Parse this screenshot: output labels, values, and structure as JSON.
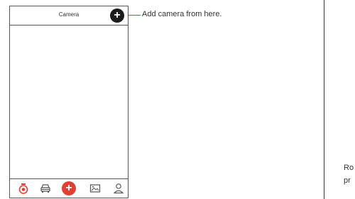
{
  "screen": {
    "title": "Camera",
    "add_button_symbol": "+"
  },
  "tabbar": {
    "items": [
      {
        "icon": "camera-record-icon",
        "active": true,
        "color": "#e04034"
      },
      {
        "icon": "car-icon",
        "active": false
      },
      {
        "icon": "add-icon",
        "symbol": "+",
        "color": "#e04034"
      },
      {
        "icon": "gallery-icon",
        "active": false
      },
      {
        "icon": "user-icon",
        "active": false
      }
    ]
  },
  "annotation": {
    "text": "Add  camera from here.",
    "line_color": "#e04034"
  },
  "next_page": {
    "line1": "Ro",
    "line2": "pr"
  },
  "colors": {
    "accent": "#e04034",
    "frame": "#555555",
    "add_button_bg": "#1b1b1b"
  }
}
